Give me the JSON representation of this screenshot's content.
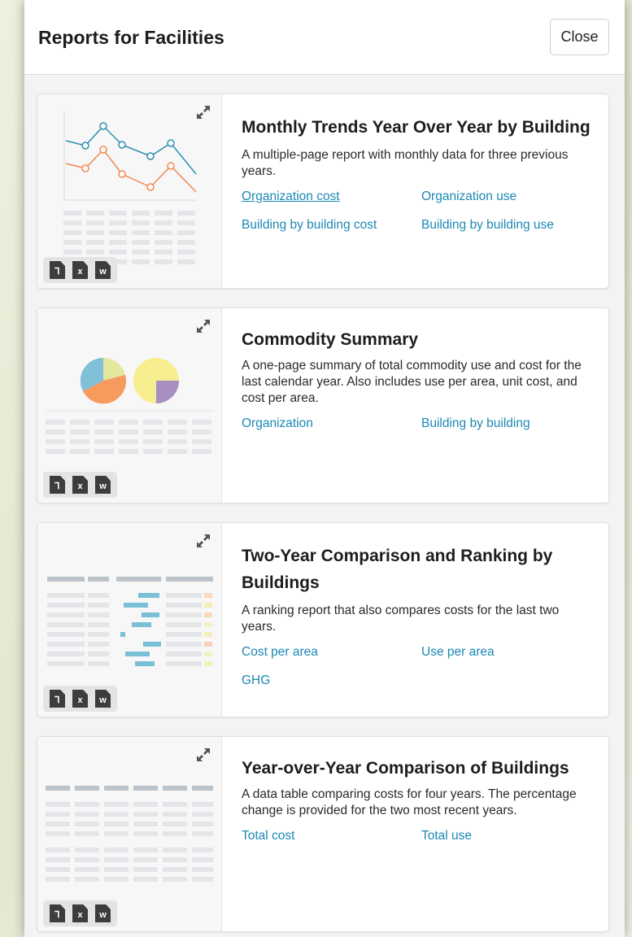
{
  "modal": {
    "title": "Reports for Facilities",
    "close_label": "Close"
  },
  "file_formats": [
    "pdf-icon",
    "excel-icon",
    "word-icon"
  ],
  "file_letters": {
    "excel": "x",
    "word": "w"
  },
  "colors": {
    "link": "#1c88b5",
    "series_blue": "#2b8fb3",
    "series_orange": "#f2874e",
    "pie_blue": "#80c0d8",
    "pie_orange": "#f79a5e",
    "pie_yellow_green": "#e3e89c",
    "pie_yellow": "#f7ee8f",
    "pie_purple": "#a78fc2"
  },
  "reports": [
    {
      "title": "Monthly Trends Year Over Year by Building",
      "description": "A multiple-page report with monthly data for three previous years.",
      "links": [
        "Organization cost",
        "Organization use",
        "Building by building cost",
        "Building by building use"
      ]
    },
    {
      "title": "Commodity Summary",
      "description": "A one-page summary of total commodity use and cost for the last calendar year. Also includes use per area, unit cost, and cost per area.",
      "links": [
        "Organization",
        "Building by building"
      ]
    },
    {
      "title": "Two-Year Comparison and Ranking by Buildings",
      "description": "A ranking report that also compares costs for the last two years.",
      "links": [
        "Cost per area",
        "Use per area",
        "GHG"
      ]
    },
    {
      "title": "Year-over-Year Comparison of Buildings",
      "description": "A data table comparing costs for four years. The percentage change is provided for the two most recent years.",
      "links": [
        "Total cost",
        "Total use"
      ]
    }
  ]
}
